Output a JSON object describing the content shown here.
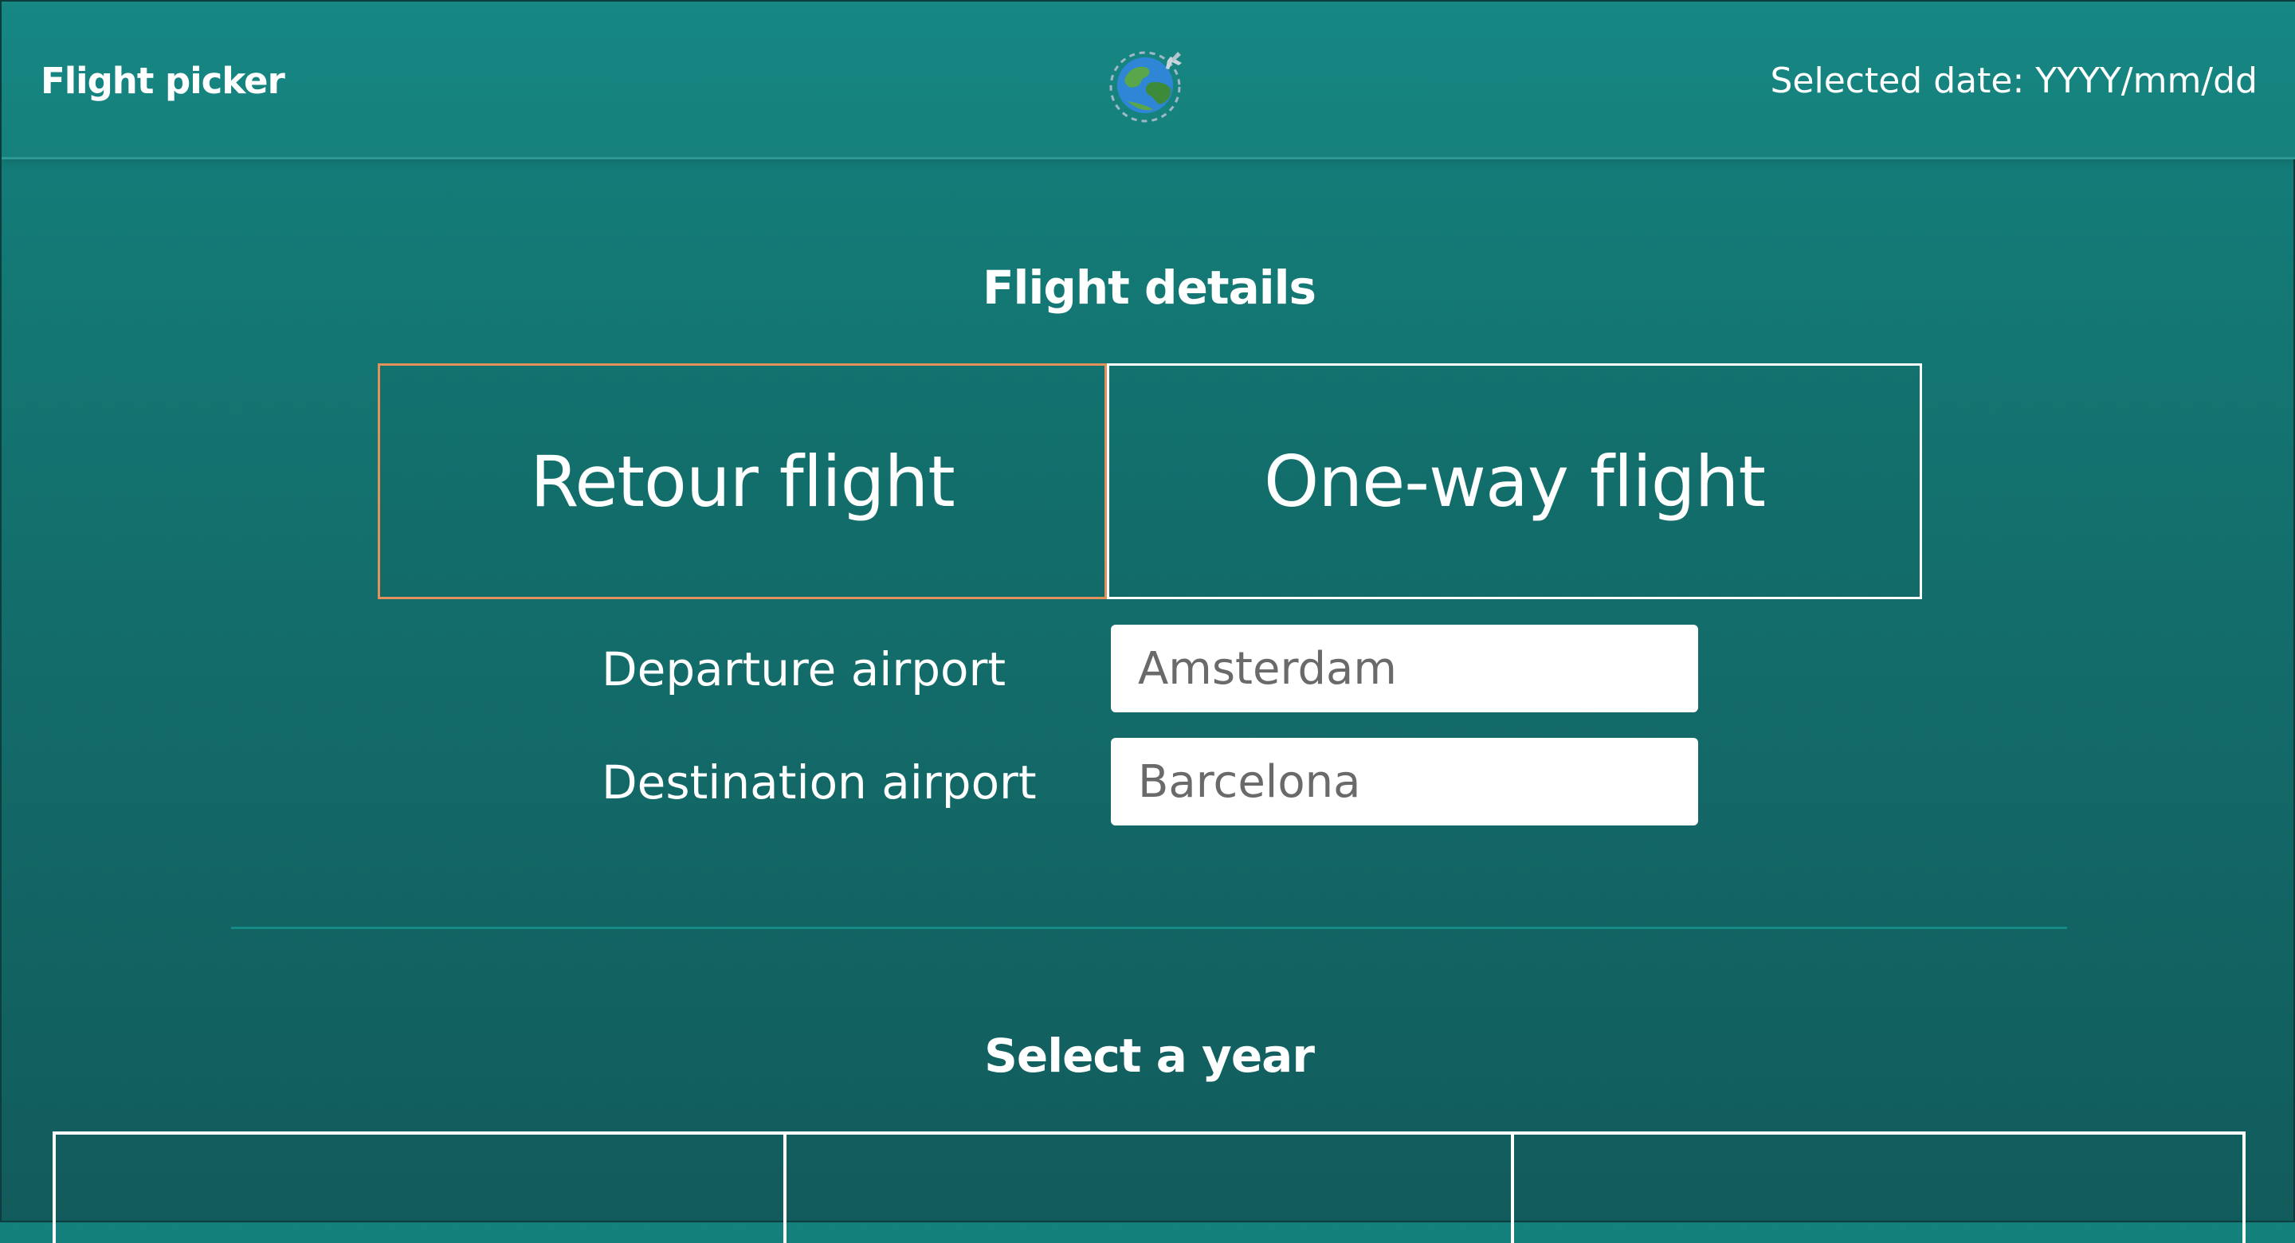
{
  "header": {
    "brand": "Flight picker",
    "logo_icon": "globe-airplane-icon",
    "selected_date": "Selected date: YYYY/mm/dd"
  },
  "flight_details": {
    "title": "Flight details",
    "retour_label": "Retour flight",
    "oneway_label": "One-way flight",
    "selected_type": "Retour flight",
    "departure_label": "Departure airport",
    "departure_placeholder": "Amsterdam",
    "destination_label": "Destination airport",
    "destination_placeholder": "Barcelona"
  },
  "year_section": {
    "title": "Select a year"
  },
  "colors": {
    "background_top": "#14817d",
    "background_bottom": "#125b5c",
    "selected_border": "#e3915a",
    "text": "#ffffff"
  }
}
